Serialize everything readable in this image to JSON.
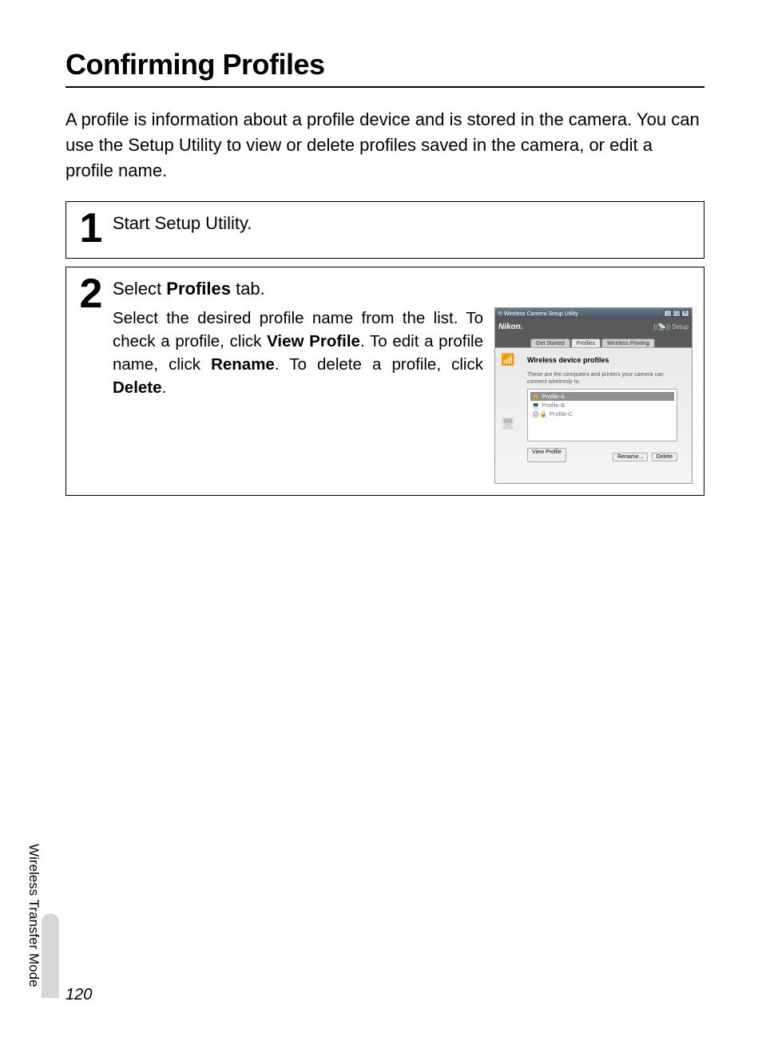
{
  "title": "Confirming Profiles",
  "intro": "A profile is information about a profile device and is stored in the camera. You can use the Setup Utility to view or delete profiles saved in the camera, or edit a profile name.",
  "steps": {
    "s1": {
      "num": "1",
      "head": "Start Setup Utility."
    },
    "s2": {
      "num": "2",
      "head_pre": "Select ",
      "head_bold": "Profiles",
      "head_post": " tab.",
      "body_1a": "Select the desired profile name from the list. To check a profile, click ",
      "body_1b": "View Profile",
      "body_1c": ". To edit a profile name, click ",
      "body_1d": "Rename",
      "body_1e": ". To delete a profile, click ",
      "body_1f": "Delete",
      "body_1g": "."
    }
  },
  "screenshot": {
    "window_title": "Wireless Camera Setup Utility",
    "brand": "Nikon.",
    "brand_setup": "Setup",
    "tabs": {
      "t1": "Get Started",
      "t2": "Profiles",
      "t3": "Wireless Printing"
    },
    "panel_heading": "Wireless device profiles",
    "panel_sub": "These are the computers and printers your camera can connect wirelessly to.",
    "profiles": {
      "p1": "Profile-A",
      "p2": "Profile-B",
      "p3": "Profile-C"
    },
    "buttons": {
      "view": "View Profile",
      "rename": "Rename...",
      "delete": "Delete"
    }
  },
  "side_tab": "Wireless Transfer Mode",
  "page_number": "120"
}
